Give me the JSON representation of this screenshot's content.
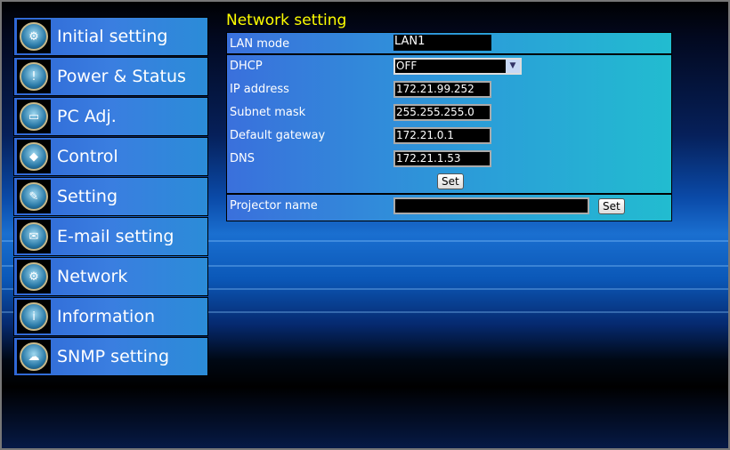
{
  "sidebar": {
    "items": [
      {
        "label": "Initial setting",
        "icon": "gear-icon"
      },
      {
        "label": "Power & Status",
        "icon": "power-status-icon"
      },
      {
        "label": "PC Adj.",
        "icon": "pc-icon"
      },
      {
        "label": "Control",
        "icon": "control-icon"
      },
      {
        "label": "Setting",
        "icon": "wrench-icon"
      },
      {
        "label": "E-mail setting",
        "icon": "mail-icon"
      },
      {
        "label": "Network",
        "icon": "network-icon"
      },
      {
        "label": "Information",
        "icon": "info-icon"
      },
      {
        "label": "SNMP setting",
        "icon": "snmp-icon"
      }
    ]
  },
  "main": {
    "title": "Network setting",
    "lan_mode": {
      "label": "LAN mode",
      "value": "LAN1"
    },
    "dhcp": {
      "label": "DHCP",
      "value": "OFF"
    },
    "ip": {
      "label": "IP address",
      "value": "172.21.99.252"
    },
    "subnet": {
      "label": "Subnet mask",
      "value": "255.255.255.0"
    },
    "gateway": {
      "label": "Default gateway",
      "value": "172.21.0.1"
    },
    "dns": {
      "label": "DNS",
      "value": "172.21.1.53"
    },
    "set_label": "Set",
    "projector_name": {
      "label": "Projector name",
      "value": ""
    }
  }
}
